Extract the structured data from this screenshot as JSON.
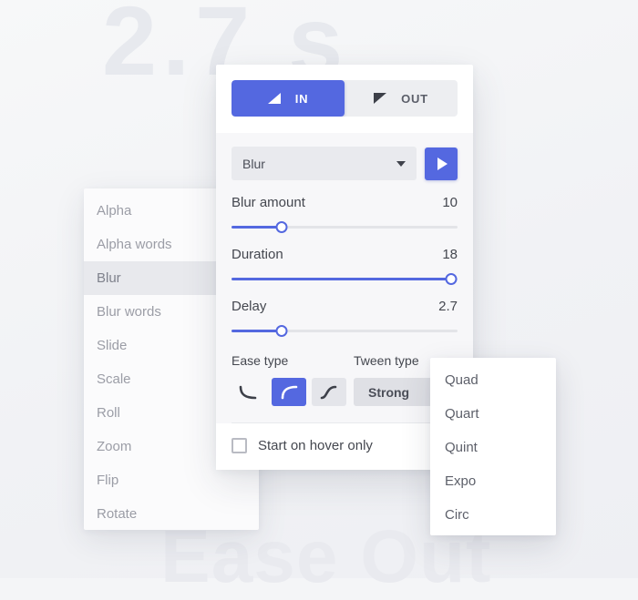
{
  "background": {
    "watermark_top": "2.7 s",
    "watermark_bottom": "Ease Out"
  },
  "sidebar": {
    "items": [
      {
        "label": "Alpha",
        "active": false
      },
      {
        "label": "Alpha words",
        "active": false
      },
      {
        "label": "Blur",
        "active": true
      },
      {
        "label": "Blur words",
        "active": false
      },
      {
        "label": "Slide",
        "active": false
      },
      {
        "label": "Scale",
        "active": false
      },
      {
        "label": "Roll",
        "active": false
      },
      {
        "label": "Zoom",
        "active": false
      },
      {
        "label": "Flip",
        "active": false
      },
      {
        "label": "Rotate",
        "active": false
      }
    ]
  },
  "panel": {
    "direction": {
      "in_label": "IN",
      "out_label": "OUT",
      "selected": "IN"
    },
    "effect_select": {
      "value": "Blur"
    },
    "sliders": [
      {
        "label": "Blur amount",
        "value": "10",
        "percent": 22
      },
      {
        "label": "Duration",
        "value": "18",
        "percent": 97
      },
      {
        "label": "Delay",
        "value": "2.7",
        "percent": 22
      }
    ],
    "ease": {
      "label": "Ease type",
      "options": [
        "ease-in",
        "ease-out",
        "ease-in-out"
      ],
      "selected": "ease-out"
    },
    "tween": {
      "label": "Tween type",
      "value": "Strong"
    },
    "hover_option": {
      "label": "Start on hover only",
      "checked": false
    }
  },
  "tween_dropdown": {
    "items": [
      "Quad",
      "Quart",
      "Quint",
      "Expo",
      "Circ"
    ]
  },
  "colors": {
    "accent": "#5468e0",
    "panel_bg": "#ffffff",
    "body_bg": "#f7f7f9"
  }
}
